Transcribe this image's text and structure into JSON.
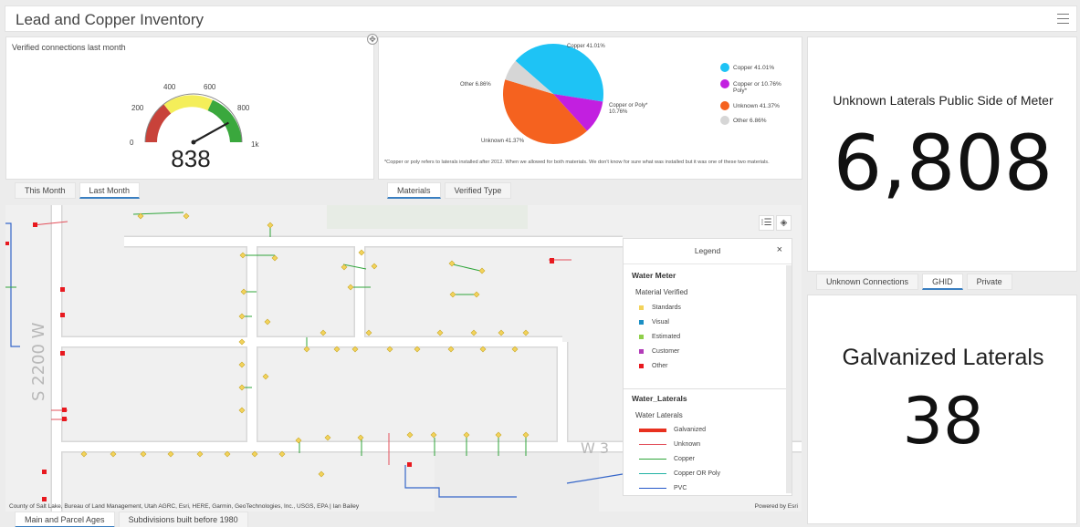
{
  "header": {
    "title": "Lead and Copper Inventory"
  },
  "gauge": {
    "title": "Verified connections last month",
    "value": "838",
    "ticks": [
      "0",
      "200",
      "400",
      "600",
      "800",
      "1k"
    ],
    "max": 1000,
    "reading": 838,
    "tabs": [
      "This Month",
      "Last Month"
    ],
    "active_tab": 1
  },
  "pie": {
    "labels": {
      "copper": "Copper 41.01%",
      "other": "Other 6.86%",
      "copper_poly_1": "Copper or Poly*",
      "copper_poly_2": "10.76%",
      "unknown": "Unknown 41.37%"
    },
    "legend": [
      {
        "label": "Copper  41.01%",
        "color": "#1ec3f5"
      },
      {
        "label": "Copper or  10.76%",
        "label2": "Poly*",
        "color": "#c21fe0"
      },
      {
        "label": "Unknown  41.37%",
        "color": "#f5621f"
      },
      {
        "label": "Other  6.86%",
        "color": "#d6d6d6"
      }
    ],
    "footnote": "*Copper or poly refers to laterals installed after 2012. When we allowed for both materials.  We don't know for sure what was installed but it was one of these two materials.",
    "tabs": [
      "Materials",
      "Verified Type"
    ],
    "active_tab": 0
  },
  "chart_data": {
    "type": "pie",
    "categories": [
      "Copper",
      "Copper or Poly*",
      "Unknown",
      "Other"
    ],
    "values": [
      41.01,
      10.76,
      41.37,
      6.86
    ],
    "colors": [
      "#1ec3f5",
      "#c21fe0",
      "#f5621f",
      "#d6d6d6"
    ]
  },
  "kpi1": {
    "title": "Unknown Laterals Public Side of Meter",
    "value": "6,808"
  },
  "kpi_tabs": {
    "items": [
      "Unknown Connections",
      "GHID",
      "Private"
    ],
    "active": 1
  },
  "kpi2": {
    "title": "Galvanized Laterals",
    "value": "38"
  },
  "map": {
    "street_label": "S 2200 W",
    "street_label_2": "W 3",
    "attribution": "County of Salt Lake, Bureau of Land Management, Utah AGRC, Esri, HERE, Garmin, GeoTechnologies, Inc., USGS, EPA | Ian Bailey",
    "powered": "Powered by Esri",
    "tools": {
      "list_icon": "⁝☰",
      "layers_icon": "◈"
    },
    "tabs": [
      "Main and Parcel Ages",
      "Subdivisions built before 1980"
    ],
    "active_tab": 0
  },
  "legend": {
    "title": "Legend",
    "close": "×",
    "section1": "Water Meter",
    "sub1": "Material Verified",
    "items1": [
      {
        "label": "Standards",
        "color": "#f3d35b"
      },
      {
        "label": "Visual",
        "color": "#1b8fc4"
      },
      {
        "label": "Estimated",
        "color": "#8fcf4a"
      },
      {
        "label": "Customer",
        "color": "#b23bb8"
      },
      {
        "label": "Other",
        "color": "#e8191f"
      }
    ],
    "section2": "Water_Laterals",
    "sub2": "Water Laterals",
    "items2": [
      {
        "label": "Galvanized",
        "color": "#e8301f",
        "width": 4
      },
      {
        "label": "Unknown",
        "color": "#e3505b",
        "width": 1.5
      },
      {
        "label": "Copper",
        "color": "#2fa53a",
        "width": 1.5
      },
      {
        "label": "Copper OR Poly",
        "color": "#22b3a4",
        "width": 1.5
      },
      {
        "label": "PVC",
        "color": "#2558c9",
        "width": 1.5
      }
    ]
  }
}
